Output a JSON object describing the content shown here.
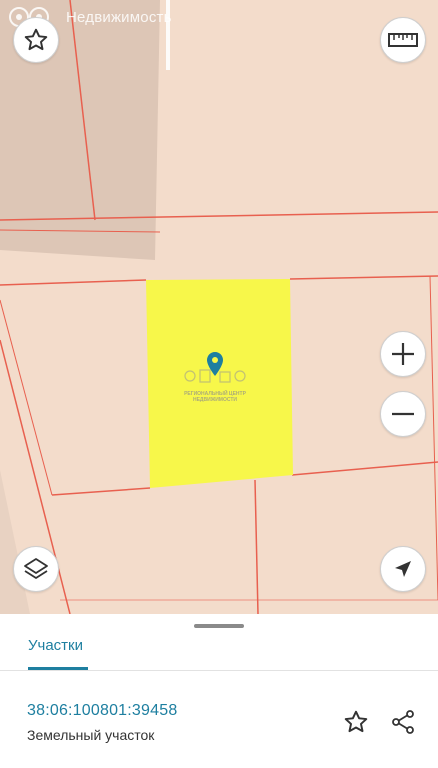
{
  "watermark": {
    "text": "Недвижимость"
  },
  "map": {
    "selected_parcel_color": "#f7f74a",
    "boundary_color": "#e8604f",
    "background_color": "#f3dccb",
    "logo_text_line1": "РЕГИОНАЛЬНЫЙ ЦЕНТР",
    "logo_text_line2": "НЕДВИЖИМОСТИ"
  },
  "controls": {
    "favorite": "star-outline-icon",
    "ruler": "ruler-icon",
    "zoom_in": "plus-icon",
    "zoom_out": "minus-icon",
    "layers": "layers-icon",
    "locate": "navigation-arrow-icon"
  },
  "sheet": {
    "tab_label": "Участки",
    "accent_color": "#1e7fa0",
    "parcel": {
      "cadastral_number": "38:06:100801:39458",
      "type": "Земельный участок"
    }
  }
}
